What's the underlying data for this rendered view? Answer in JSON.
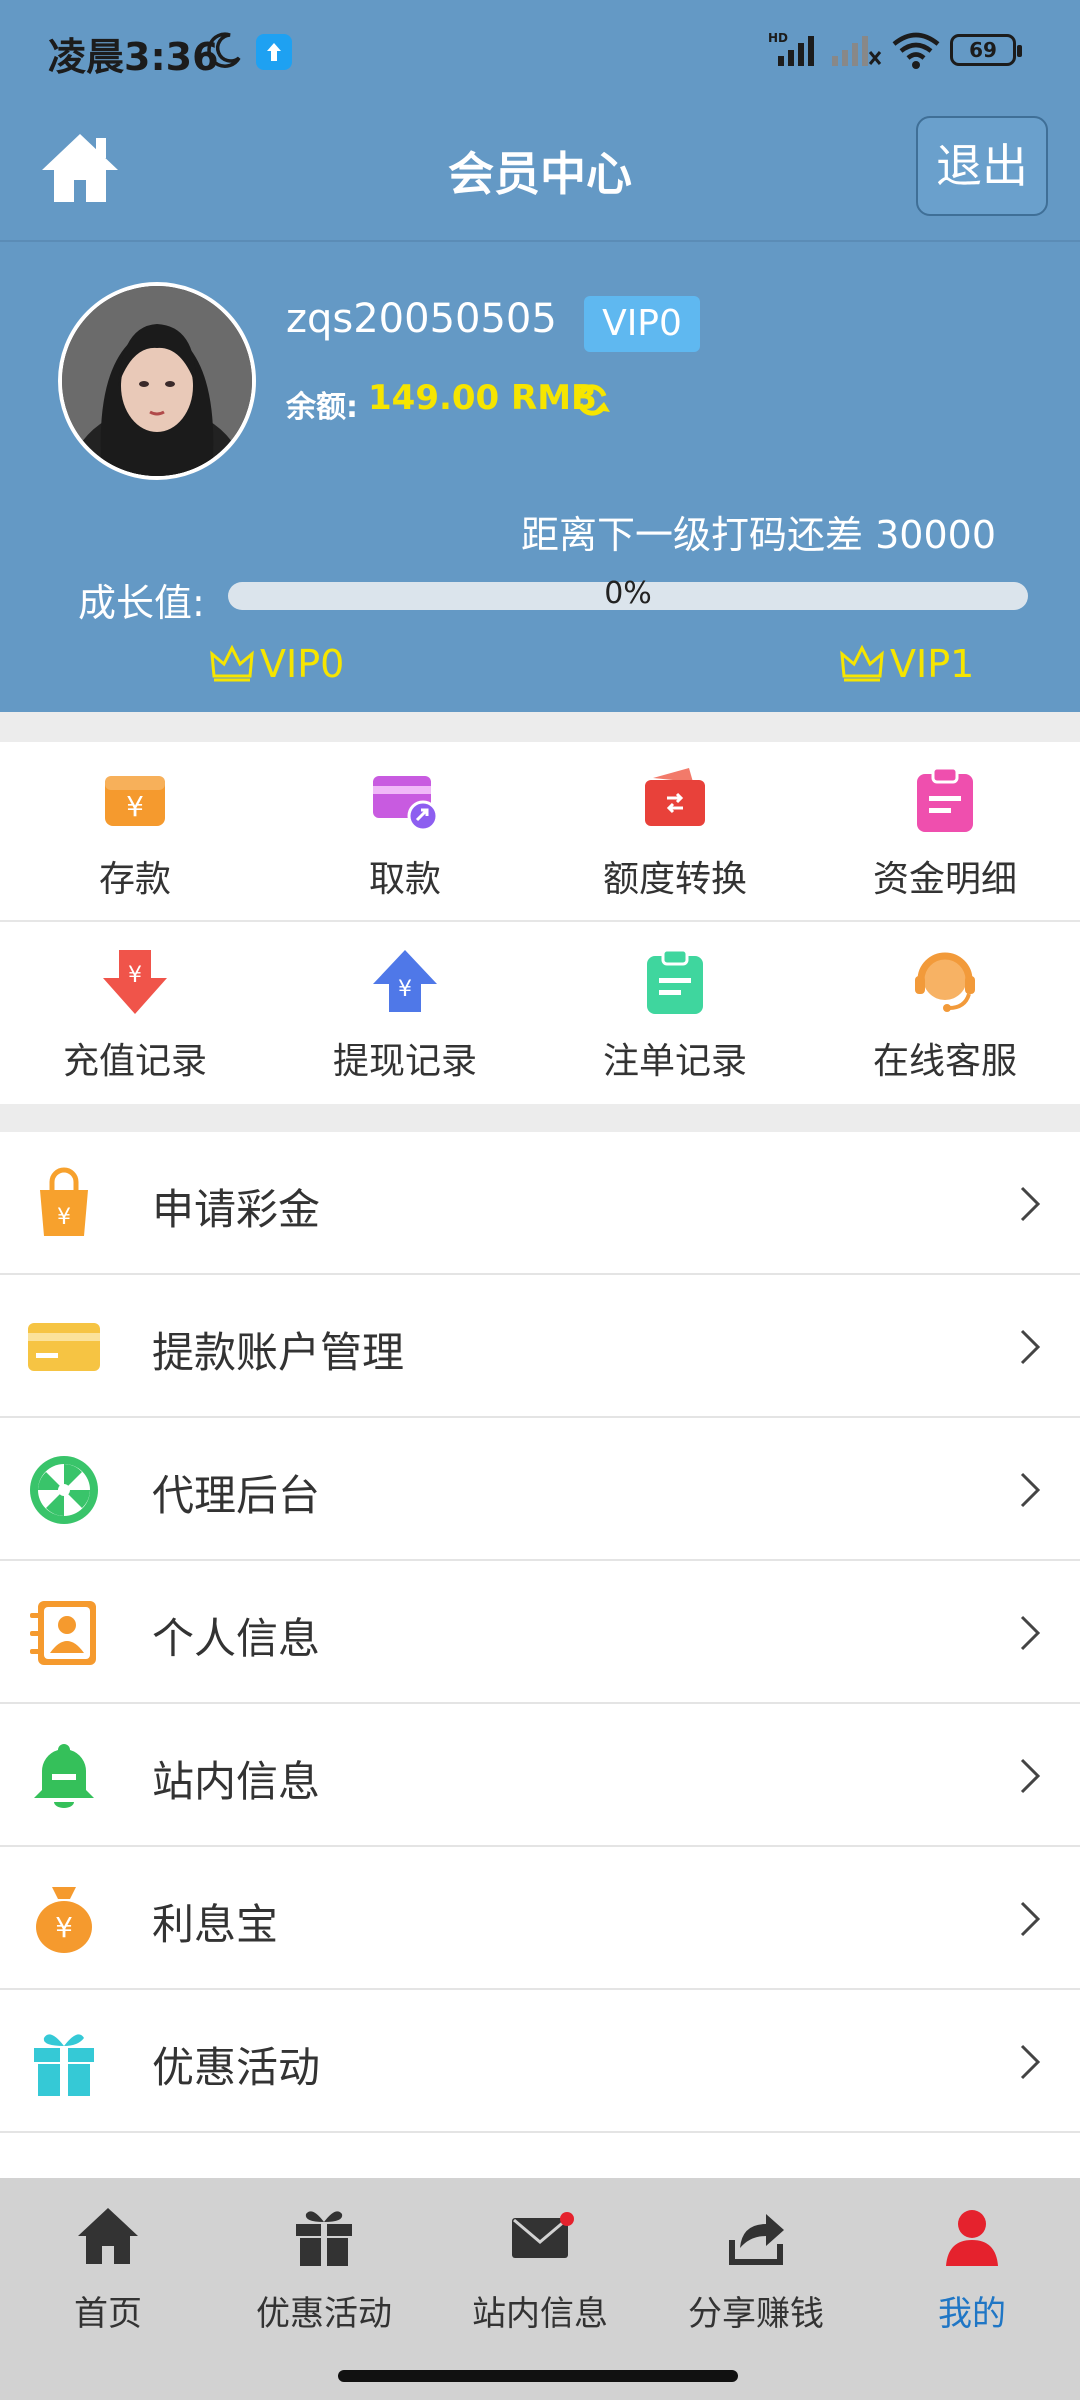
{
  "status_bar": {
    "time": "凌晨3:36",
    "battery": "69"
  },
  "header": {
    "title": "会员中心",
    "logout_label": "退出"
  },
  "profile": {
    "username": "zqs20050505",
    "vip_badge": "VIP0",
    "balance_label": "余额:",
    "balance_value": "149.00 RMB",
    "next_level_text": "距离下一级打码还差 30000",
    "growth_label": "成长值:",
    "progress_text": "0%",
    "progress_fraction": 0.0,
    "current_level": "VIP0",
    "next_level": "VIP1"
  },
  "quick_actions": [
    {
      "label": "存款",
      "icon": "deposit-wallet-icon",
      "color": "#f59a2e"
    },
    {
      "label": "取款",
      "icon": "withdraw-card-icon",
      "color": "#c85be0"
    },
    {
      "label": "额度转换",
      "icon": "transfer-icon",
      "color": "#e8413a"
    },
    {
      "label": "资金明细",
      "icon": "fund-details-icon",
      "color": "#ef4fae"
    },
    {
      "label": "充值记录",
      "icon": "recharge-record-icon",
      "color": "#f0544a"
    },
    {
      "label": "提现记录",
      "icon": "withdraw-record-icon",
      "color": "#4f78e8"
    },
    {
      "label": "注单记录",
      "icon": "bet-record-icon",
      "color": "#3fd69e"
    },
    {
      "label": "在线客服",
      "icon": "customer-service-icon",
      "color": "#f29a3a"
    }
  ],
  "menu": [
    {
      "label": "申请彩金",
      "icon": "shopping-bag-icon"
    },
    {
      "label": "提款账户管理",
      "icon": "bank-card-icon"
    },
    {
      "label": "代理后台",
      "icon": "wheel-icon"
    },
    {
      "label": "个人信息",
      "icon": "contact-book-icon"
    },
    {
      "label": "站内信息",
      "icon": "bell-icon"
    },
    {
      "label": "利息宝",
      "icon": "money-bag-icon"
    },
    {
      "label": "优惠活动",
      "icon": "gift-icon"
    }
  ],
  "bottom_nav": [
    {
      "label": "首页",
      "icon": "home-icon"
    },
    {
      "label": "优惠活动",
      "icon": "gift-icon"
    },
    {
      "label": "站内信息",
      "icon": "mail-icon"
    },
    {
      "label": "分享赚钱",
      "icon": "share-icon"
    },
    {
      "label": "我的",
      "icon": "user-icon",
      "active": true
    }
  ]
}
